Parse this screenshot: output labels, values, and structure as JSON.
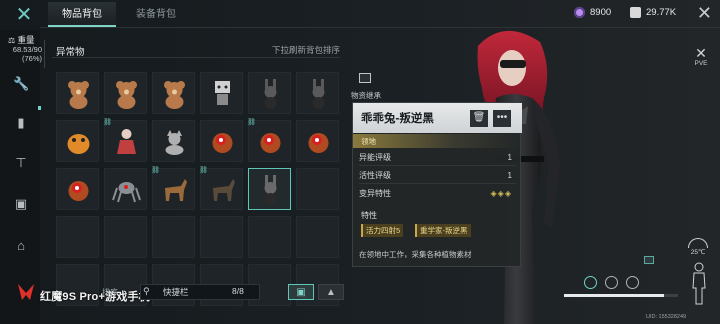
{
  "top": {
    "tabs": [
      {
        "label": "物品背包"
      },
      {
        "label": "装备背包"
      }
    ],
    "currency": [
      {
        "value": "8900",
        "icon": "crystal-icon",
        "color": "#b98ef0"
      },
      {
        "value": "29.77K",
        "icon": "coin-icon",
        "color": "#d9d9d9"
      }
    ]
  },
  "sidebar": {
    "weight_label": "重量",
    "weight_value": "68.53/90",
    "weight_pct": "(76%)",
    "icons": [
      "wrench-icon",
      "canister-icon",
      "hammer-icon",
      "toolbox-icon",
      "home-icon"
    ]
  },
  "inventory": {
    "category": "异常物",
    "sort_hint": "下拉刷新背包排序",
    "items": [
      {
        "icon": "teddy-bear-icon",
        "color": "#b87a4a",
        "linked": false
      },
      {
        "icon": "teddy-bear-icon",
        "color": "#b87a4a",
        "linked": false
      },
      {
        "icon": "teddy-bear-icon",
        "color": "#b87a4a",
        "linked": false
      },
      {
        "icon": "robot-icon",
        "color": "#d0d0d0",
        "linked": false
      },
      {
        "icon": "dark-rabbit-icon",
        "color": "#5a5a5a",
        "linked": false
      },
      {
        "icon": "dark-rabbit-icon",
        "color": "#5a5a5a",
        "linked": false
      },
      {
        "icon": "orange-creature-icon",
        "color": "#e08a2a",
        "linked": false
      },
      {
        "icon": "red-doll-icon",
        "color": "#c04040",
        "linked": true
      },
      {
        "icon": "grey-cat-icon",
        "color": "#b0b0b0",
        "linked": false
      },
      {
        "icon": "red-eye-creature-icon",
        "color": "#b04a20",
        "linked": false
      },
      {
        "icon": "red-eye-creature-icon",
        "color": "#b04a20",
        "linked": true
      },
      {
        "icon": "red-eye-creature-icon",
        "color": "#b04a20",
        "linked": false
      },
      {
        "icon": "red-eye-creature-icon",
        "color": "#b04a20",
        "linked": false
      },
      {
        "icon": "mech-spider-icon",
        "color": "#8a8f95",
        "linked": false
      },
      {
        "icon": "horse-icon",
        "color": "#9a6a3a",
        "linked": true
      },
      {
        "icon": "dark-horse-icon",
        "color": "#5a4a3a",
        "linked": true
      },
      {
        "icon": "dark-rabbit-icon",
        "color": "#6a6a6a",
        "linked": false,
        "selected": true
      }
    ],
    "search_placeholder": "快捷栏",
    "search_count": "8/8",
    "sort_label": "排序"
  },
  "detail": {
    "section_label": "物资继承",
    "name": "乖乖兔-叛逆黑",
    "rank": "领地",
    "rows": [
      {
        "label": "异能评级",
        "value": "1"
      },
      {
        "label": "活性评级",
        "value": "1"
      },
      {
        "label": "变异特性",
        "value": "◈◈◈"
      }
    ],
    "traits_label": "特性",
    "traits": [
      "活力四射5",
      "重学家-叛逆黑"
    ],
    "description": "在领地中工作，采集各种植物素材"
  },
  "hud": {
    "mode": "PVE",
    "temperature": "25℃",
    "uid": "UID: 155328249"
  },
  "watermark": "红魔9S Pro+游戏手机"
}
